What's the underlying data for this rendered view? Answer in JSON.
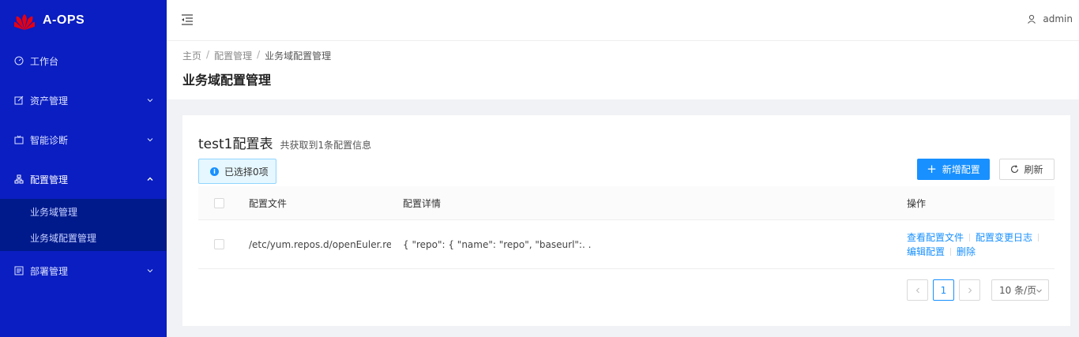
{
  "app": {
    "name": "A-OPS"
  },
  "sidebar": {
    "items": [
      {
        "label": "工作台",
        "icon": "dashboard-icon"
      },
      {
        "label": "资产管理",
        "icon": "edit-icon"
      },
      {
        "label": "智能诊断",
        "icon": "monitor-icon"
      },
      {
        "label": "配置管理",
        "icon": "cluster-icon",
        "open": true,
        "children": [
          {
            "label": "业务域管理"
          },
          {
            "label": "业务域配置管理"
          }
        ]
      },
      {
        "label": "部署管理",
        "icon": "deploy-icon"
      }
    ]
  },
  "header": {
    "user": "admin"
  },
  "breadcrumb": [
    "主页",
    "配置管理",
    "业务域配置管理"
  ],
  "page": {
    "title": "业务域配置管理"
  },
  "card": {
    "title": "test1配置表",
    "subtitle": "共获取到1条配置信息",
    "selected_text": "已选择0项",
    "add_button": "新增配置",
    "refresh_button": "刷新"
  },
  "table": {
    "columns": [
      "配置文件",
      "配置详情",
      "操作"
    ],
    "rows": [
      {
        "file": "/etc/yum.repos.d/openEuler.repo",
        "detail": "{ \"repo\": { \"name\": \"repo\", \"baseurl\":. .",
        "actions": [
          "查看配置文件",
          "配置变更日志",
          "编辑配置",
          "删除"
        ]
      }
    ]
  },
  "pagination": {
    "current": "1",
    "page_size": "10 条/页"
  },
  "colors": {
    "sidebar": "#0a1ec1",
    "primary": "#1890ff"
  }
}
